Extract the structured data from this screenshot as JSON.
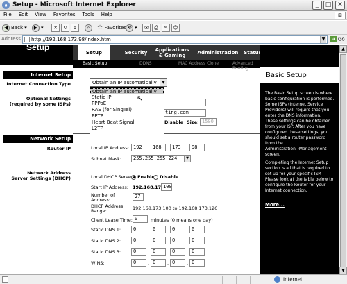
{
  "window": {
    "title": "Setup - Microsoft Internet Explorer",
    "min": "_",
    "max": "□",
    "close": "✕"
  },
  "menu": [
    "File",
    "Edit",
    "View",
    "Favorites",
    "Tools",
    "Help"
  ],
  "toolbar": {
    "back": "Back",
    "favorites": "Favorites"
  },
  "address": {
    "label": "Address",
    "url": "http://192.168.173.98/index.htm",
    "go": "Go"
  },
  "brand": {
    "section": "Setup"
  },
  "tabs": [
    {
      "label": "Setup"
    },
    {
      "label": "Security"
    },
    {
      "label": "Applications & Gaming"
    },
    {
      "label": "Administration"
    },
    {
      "label": "Status"
    }
  ],
  "subtabs": [
    {
      "label": "Basic Setup"
    },
    {
      "label": "DDNS"
    },
    {
      "label": "MAC Address Clone"
    },
    {
      "label": "Advanced Routing"
    }
  ],
  "left": {
    "internet_setup": "Internet Setup",
    "connection_type": "Internet Connection Type",
    "optional_settings": "Optional Settings",
    "optional_note": "(required by some ISPs)",
    "network_setup": "Network Setup",
    "router_ip": "Router IP",
    "nas_line1": "Network Address",
    "nas_line2": "Server Settings (DHCP)"
  },
  "connection": {
    "selected": "Obtain an IP automatically",
    "options": [
      "Obtain an IP automatically",
      "Static IP",
      "PPPoE",
      "RAS (for SingTel)",
      "PPTP",
      "Heart Beat Signal",
      "L2TP"
    ]
  },
  "optional": {
    "domain_fragment": "ting.com",
    "mtu_state": "Disable",
    "size_label": "Size:",
    "size_value": "1500"
  },
  "router": {
    "local_ip_label": "Local IP Address:",
    "ip": [
      "192",
      "168",
      "173",
      "98"
    ],
    "subnet_label": "Subnet Mask:",
    "subnet": "255.255.255.224"
  },
  "dhcp": {
    "server_label": "Local DHCP Server:",
    "enable": "Enable",
    "disable": "Disable",
    "start_label": "Start IP Address:",
    "start_prefix": "192.168.173.",
    "start_value": "100",
    "number_label_1": "Number of",
    "number_label_2": "Address:",
    "number_value": "27",
    "range_label_1": "DHCP  Address",
    "range_label_2": "Range:",
    "range_value": "192.168.173.100 to 192.168.173.126",
    "lease_label": "Client Lease Time:",
    "lease_value": "0",
    "lease_note": "minutes (0 means one day)",
    "dns1_label": "Static DNS 1:",
    "dns2_label": "Static DNS 2:",
    "dns3_label": "Static DNS 3:",
    "wins_label": "WINS:",
    "zero": "0"
  },
  "help": {
    "title": "Basic Setup",
    "para1": "The Basic Setup screen is where basic configuration is performed. Some ISPs (Internet Service Providers) will require that you enter the DNS information. These settings can be obtained from your ISP. After you have configured these settings, you should set a router password from the Administration→Management screen.",
    "para2": "Completing the Internet Setup section is all that is required to set up for your specific ISP. Please look at the table below to configure the Router for your Internet connection.",
    "more": "More..."
  },
  "status": {
    "zone": "Internet"
  }
}
